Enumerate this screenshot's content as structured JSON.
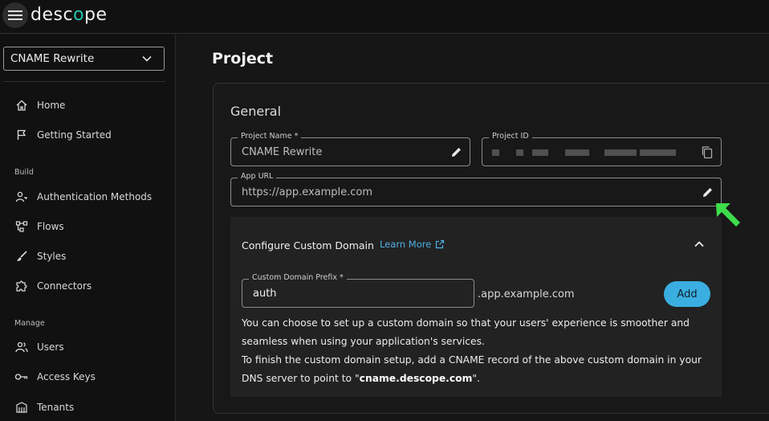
{
  "brand": {
    "logo_pre": "desc",
    "logo_o": "o",
    "logo_post": "pe"
  },
  "sidebar": {
    "project_select": "CNAME Rewrite",
    "items_top": [
      {
        "label": "Home",
        "icon": "home-icon"
      },
      {
        "label": "Getting Started",
        "icon": "flag-icon"
      }
    ],
    "build_label": "Build",
    "items_build": [
      {
        "label": "Authentication Methods",
        "icon": "user-key-icon"
      },
      {
        "label": "Flows",
        "icon": "flows-icon"
      },
      {
        "label": "Styles",
        "icon": "brush-icon"
      },
      {
        "label": "Connectors",
        "icon": "puzzle-icon"
      }
    ],
    "manage_label": "Manage",
    "items_manage": [
      {
        "label": "Users",
        "icon": "users-icon"
      },
      {
        "label": "Access Keys",
        "icon": "key-icon"
      },
      {
        "label": "Tenants",
        "icon": "building-icon"
      }
    ]
  },
  "main": {
    "title": "Project",
    "general": {
      "title": "General",
      "project_name_label": "Project Name *",
      "project_name_value": "CNAME Rewrite",
      "project_id_label": "Project ID",
      "app_url_label": "App URL",
      "app_url_value": "https://app.example.com"
    },
    "custom_domain": {
      "title": "Configure Custom Domain",
      "learn_more": "Learn More",
      "prefix_label": "Custom Domain Prefix *",
      "prefix_value": "auth",
      "suffix": ".app.example.com",
      "add_label": "Add",
      "desc_1": "You can choose to set up a custom domain so that your users' experience is smoother and seamless when using your application's services.",
      "desc_2_pre": "To finish the custom domain setup, add a CNAME record of the above custom domain in your DNS server to point to \"",
      "desc_2_bold": "cname.descope.com",
      "desc_2_post": "\"."
    }
  },
  "colors": {
    "accent": "#3aaee0",
    "link": "#4fb0e6",
    "cursor": "#3ddc4a",
    "logo_o": "#20c6ad"
  }
}
